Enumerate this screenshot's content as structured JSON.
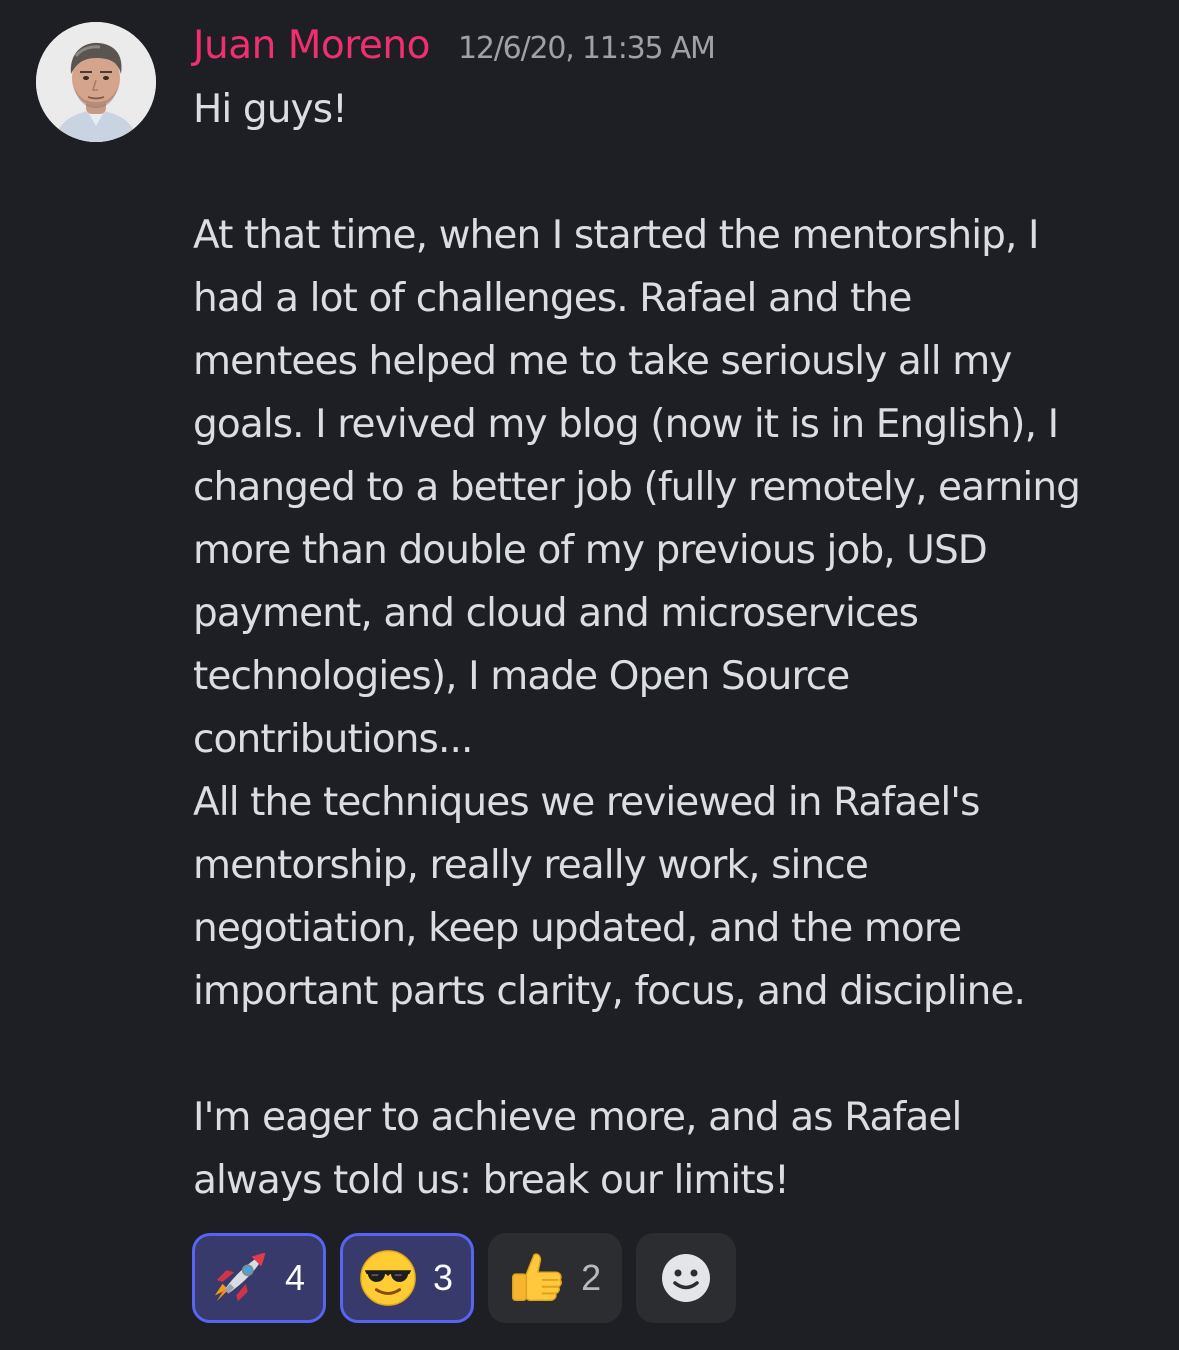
{
  "message": {
    "author": "Juan Moreno",
    "timestamp": "12/6/20, 11:35 AM",
    "author_color": "#ef2f6e",
    "lines": [
      "Hi guys!",
      "",
      "At that time, when I started the mentorship, I",
      "had a lot of challenges. Rafael and the",
      "mentees helped me to take seriously all my",
      "goals. I revived my blog (now it is in English), I",
      "changed to a better job (fully remotely, earning",
      "more than double of my previous job, USD",
      "payment, and cloud and microservices",
      "technologies), I made Open Source",
      "contributions...",
      "All the techniques we reviewed in Rafael's",
      "mentorship, really really work, since",
      "negotiation, keep updated, and the more",
      "important parts clarity, focus, and discipline.",
      "",
      "I'm eager to achieve more, and as Rafael",
      "always told us: break our limits!"
    ]
  },
  "reactions": [
    {
      "emoji": "rocket-emoji",
      "count": "4",
      "selected": true
    },
    {
      "emoji": "sunglasses-emoji",
      "count": "3",
      "selected": true
    },
    {
      "emoji": "thumbs-up-emoji",
      "count": "2",
      "selected": false
    }
  ],
  "add_reaction": {
    "icon": "smiley-add-reaction-icon"
  },
  "colors": {
    "background": "#1e1f25",
    "text": "#dbdee1",
    "timestamp": "#9ea1a8",
    "reaction_bg": "#2b2d31",
    "reaction_selected_bg": "#373a6b",
    "reaction_selected_border": "#5865f2"
  }
}
